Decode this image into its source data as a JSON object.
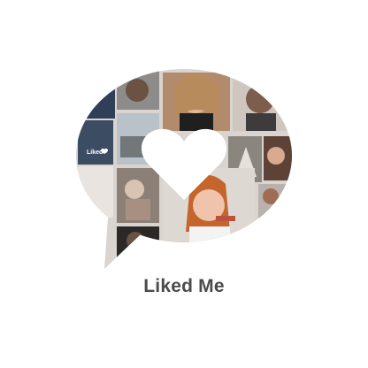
{
  "screen": {
    "caption": "Liked Me",
    "tile_label": "Liked"
  },
  "icons": {
    "badge": "liked-me-speech-bubble",
    "center": "heart-icon",
    "tile": "small-heart-icon"
  },
  "colors": {
    "background": "#ffffff",
    "caption": "#4b4b4b",
    "heart": "#ffffff"
  }
}
